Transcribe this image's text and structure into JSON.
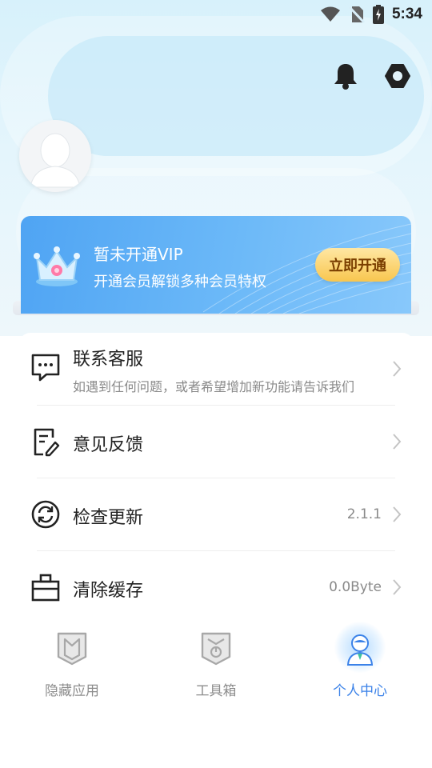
{
  "status_bar": {
    "time": "5:34"
  },
  "header": {
    "bell_icon": "bell-icon",
    "settings_icon": "settings-icon"
  },
  "vip": {
    "title": "暂未开通VIP",
    "subtitle": "开通会员解锁多种会员特权",
    "button_label": "立即开通"
  },
  "menu": {
    "items": [
      {
        "title": "联系客服",
        "desc": "如遇到任何问题，或者希望增加新功能请告诉我们",
        "value": ""
      },
      {
        "title": "意见反馈",
        "desc": "",
        "value": ""
      },
      {
        "title": "检查更新",
        "desc": "",
        "value": "2.1.1"
      },
      {
        "title": "清除缓存",
        "desc": "",
        "value": "0.0Byte"
      }
    ]
  },
  "bottom_nav": {
    "items": [
      {
        "label": "隐藏应用"
      },
      {
        "label": "工具箱"
      },
      {
        "label": "个人中心"
      }
    ],
    "active_index": 2
  },
  "colors": {
    "accent": "#3b82e8",
    "vip_blue": "#5aaaf5",
    "vip_button": "#f8c64f"
  }
}
